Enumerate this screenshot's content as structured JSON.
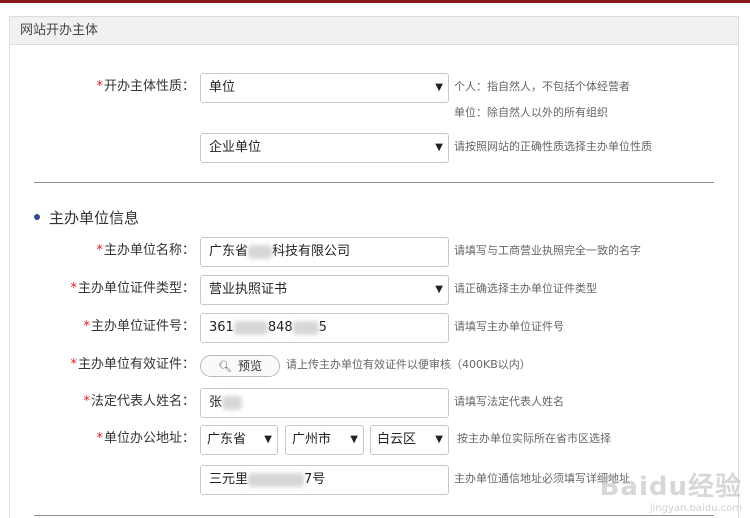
{
  "panel": {
    "title": "网站开办主体"
  },
  "nature": {
    "label": "开办主体性质：",
    "value": "单位",
    "hint_line1": "个人：指自然人，不包括个体经营者",
    "hint_line2": "单位：除自然人以外的所有组织"
  },
  "unit_type": {
    "value": "企业单位",
    "hint": "请按照网站的正确性质选择主办单位性质"
  },
  "section": {
    "title": "主办单位信息"
  },
  "org_name": {
    "label": "主办单位名称：",
    "value_prefix": "广东省",
    "value_suffix": "科技有限公司",
    "hint": "请填写与工商营业执照完全一致的名字"
  },
  "cert_type": {
    "label": "主办单位证件类型：",
    "value": "营业执照证书",
    "hint": "请正确选择主办单位证件类型"
  },
  "cert_no": {
    "label": "主办单位证件号：",
    "value_prefix": "361",
    "value_mid": "848",
    "value_suffix": "5",
    "hint": "请填写主办单位证件号"
  },
  "cert_file": {
    "label": "主办单位有效证件：",
    "button_label": "预览",
    "hint": "请上传主办单位有效证件以便审核（400KB以内）"
  },
  "legal_rep": {
    "label": "法定代表人姓名：",
    "value_prefix": "张",
    "hint": "请填写法定代表人姓名"
  },
  "address": {
    "label": "单位办公地址：",
    "province": "广东省",
    "city": "广州市",
    "district": "白云区",
    "hint": "按主办单位实际所在省市区选择",
    "detail_prefix": "三元里",
    "detail_suffix": "7号",
    "detail_hint": "主办单位通信地址必须填写详细地址"
  },
  "watermark": {
    "brand": "Baidu经验",
    "url": "jingyan.baidu.com"
  },
  "icons": {
    "dropdown": "dropdown-arrow-icon",
    "preview": "magnifier-icon"
  },
  "colors": {
    "required_mark": "#e02020",
    "section_dot": "#2e4b8a",
    "top_bar": "#8a1a1a"
  }
}
